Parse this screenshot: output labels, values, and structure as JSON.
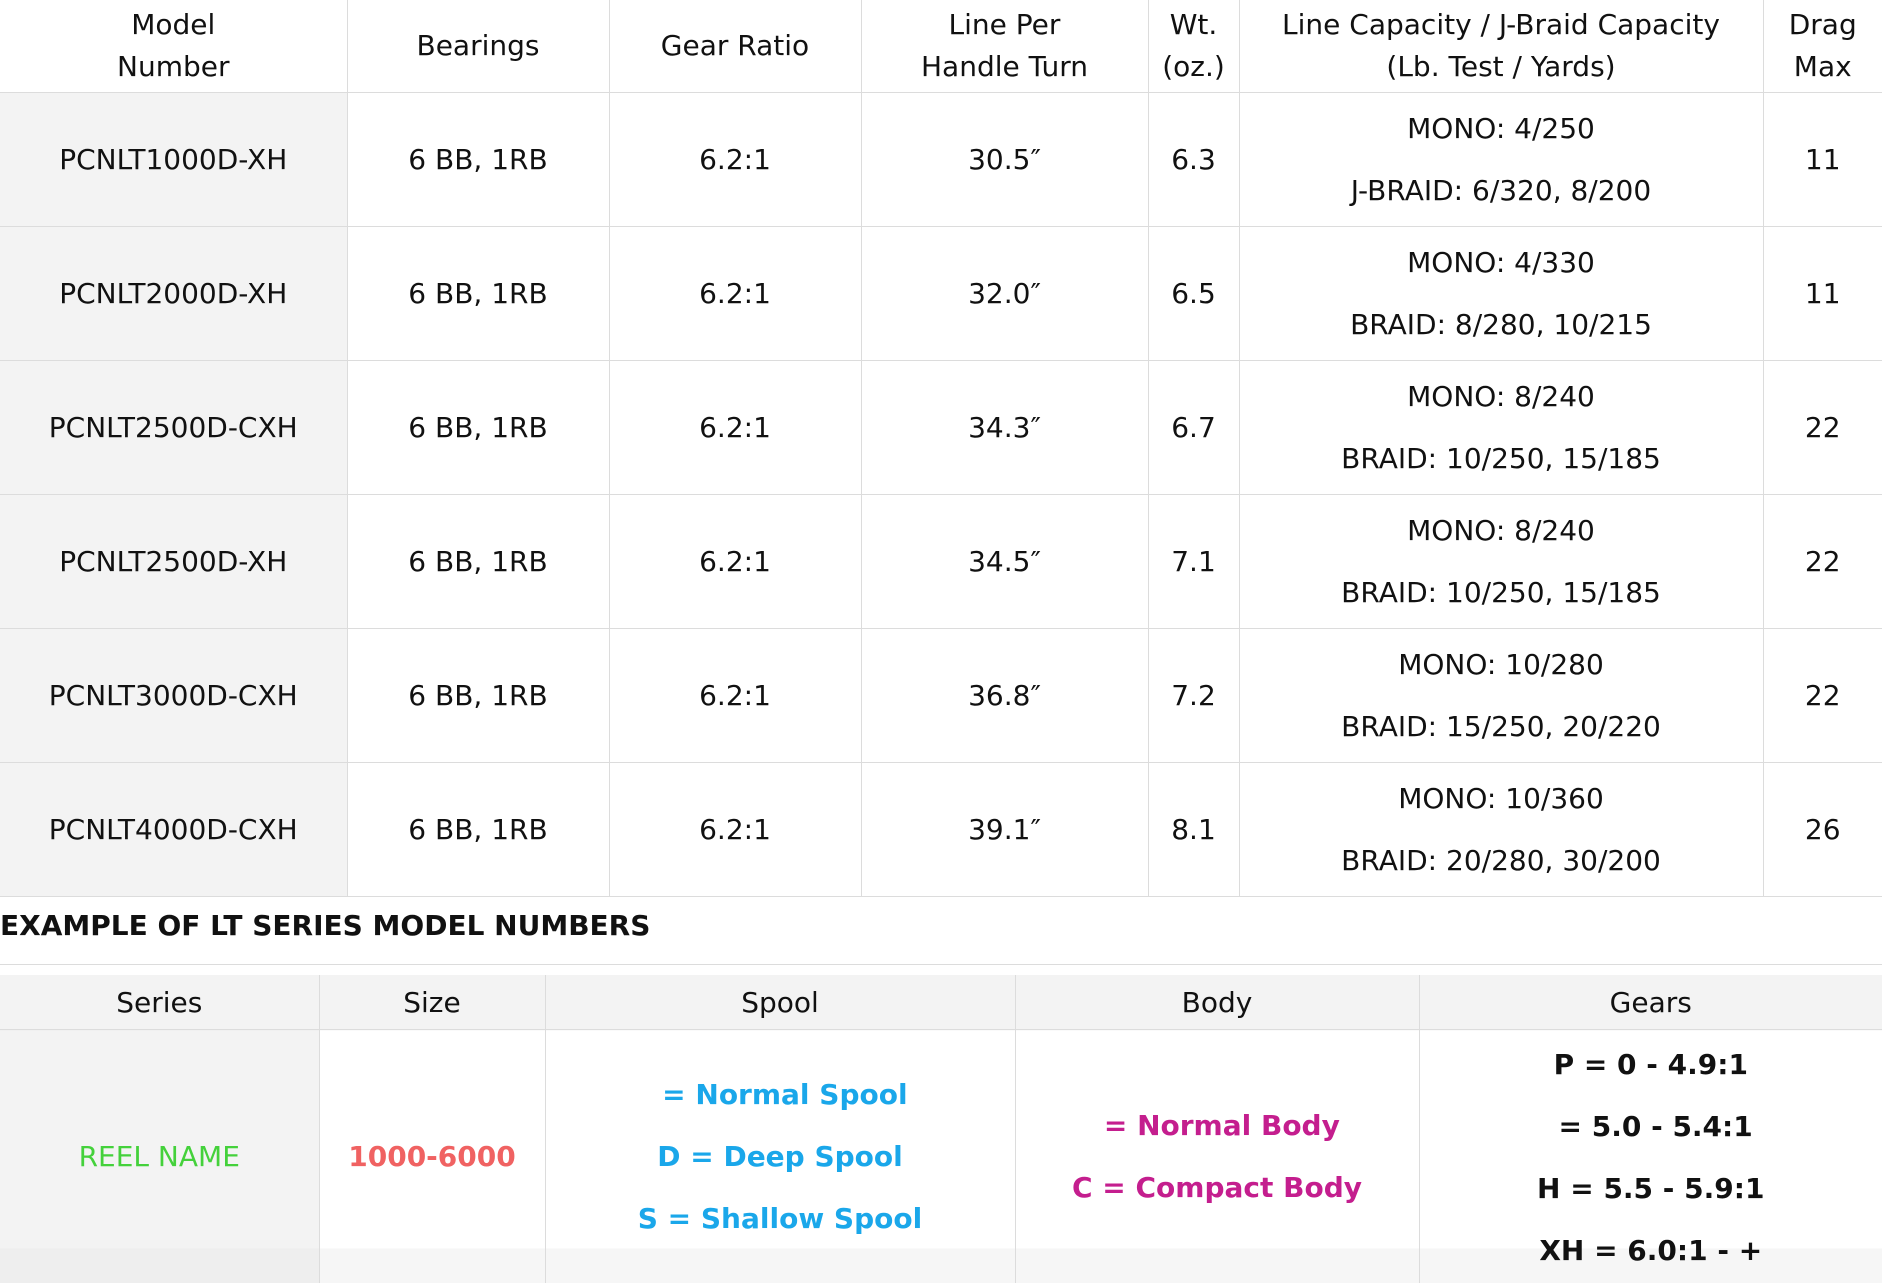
{
  "specs_table": {
    "headers": [
      {
        "line1": "Model",
        "line2": "Number"
      },
      {
        "line1": "Bearings",
        "line2": ""
      },
      {
        "line1": "Gear Ratio",
        "line2": ""
      },
      {
        "line1": "Line Per",
        "line2": "Handle Turn"
      },
      {
        "line1": "Wt.",
        "line2": "(oz.)"
      },
      {
        "line1": "Line Capacity / J-Braid Capacity",
        "line2": "(Lb. Test / Yards)"
      },
      {
        "line1": "Drag",
        "line2": "Max"
      }
    ],
    "rows": [
      {
        "model": "PCNLT1000D-XH",
        "bearings": "6 BB, 1RB",
        "gear_ratio": "6.2:1",
        "line_per_turn": "30.5″",
        "weight": "6.3",
        "cap_mono": "MONO: 4/250",
        "cap_braid": "J-BRAID: 6/320, 8/200",
        "drag_max": "11"
      },
      {
        "model": "PCNLT2000D-XH",
        "bearings": "6 BB, 1RB",
        "gear_ratio": "6.2:1",
        "line_per_turn": "32.0″",
        "weight": "6.5",
        "cap_mono": "MONO: 4/330",
        "cap_braid": "BRAID: 8/280, 10/215",
        "drag_max": "11"
      },
      {
        "model": "PCNLT2500D-CXH",
        "bearings": "6 BB, 1RB",
        "gear_ratio": "6.2:1",
        "line_per_turn": "34.3″",
        "weight": "6.7",
        "cap_mono": "MONO: 8/240",
        "cap_braid": "BRAID: 10/250, 15/185",
        "drag_max": "22"
      },
      {
        "model": "PCNLT2500D-XH",
        "bearings": "6 BB, 1RB",
        "gear_ratio": "6.2:1",
        "line_per_turn": "34.5″",
        "weight": "7.1",
        "cap_mono": "MONO: 8/240",
        "cap_braid": "BRAID: 10/250, 15/185",
        "drag_max": "22"
      },
      {
        "model": "PCNLT3000D-CXH",
        "bearings": "6 BB, 1RB",
        "gear_ratio": "6.2:1",
        "line_per_turn": "36.8″",
        "weight": "7.2",
        "cap_mono": "MONO: 10/280",
        "cap_braid": "BRAID: 15/250, 20/220",
        "drag_max": "22"
      },
      {
        "model": "PCNLT4000D-CXH",
        "bearings": "6 BB, 1RB",
        "gear_ratio": "6.2:1",
        "line_per_turn": "39.1″",
        "weight": "8.1",
        "cap_mono": "MONO: 10/360",
        "cap_braid": "BRAID: 20/280, 30/200",
        "drag_max": "26"
      }
    ]
  },
  "example_section": {
    "title": "EXAMPLE OF LT SERIES MODEL NUMBERS",
    "headers": [
      "Series",
      "Size",
      "Spool",
      "Body",
      "Gears"
    ],
    "series": "REEL NAME",
    "size": "1000-6000",
    "spool": [
      " = Normal Spool",
      "D = Deep Spool",
      "S = Shallow Spool"
    ],
    "body": [
      " = Normal Body",
      "C = Compact Body"
    ],
    "gears": [
      "P = 0 - 4.9:1",
      " = 5.0 - 5.4:1",
      "H = 5.5 - 5.9:1",
      "XH = 6.0:1 - +"
    ],
    "colors": {
      "series": "#44d13b",
      "size": "#f06262",
      "spool": "#1aa7ea",
      "body": "#c41e8e"
    }
  }
}
